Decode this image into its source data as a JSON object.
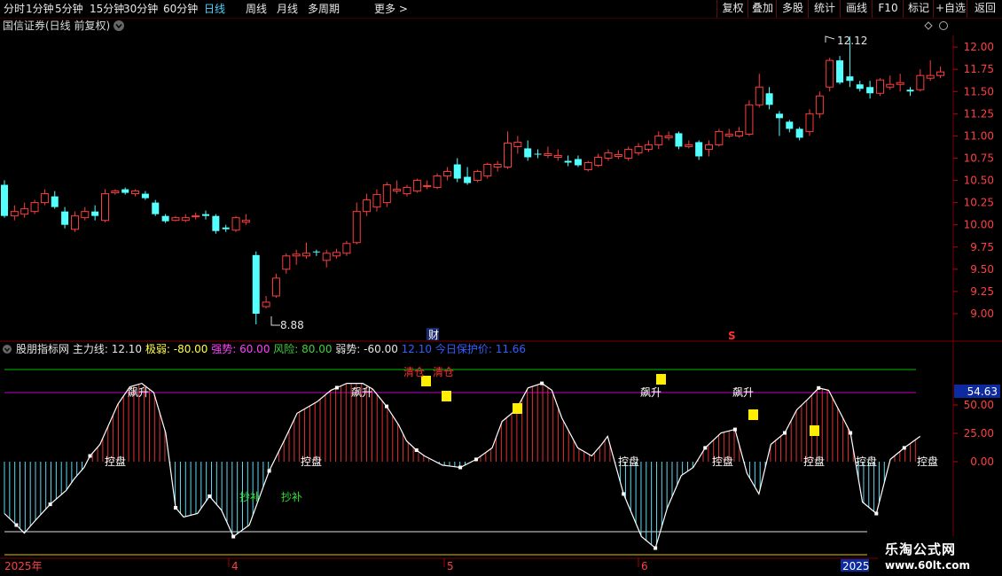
{
  "toolbar": {
    "periods": [
      "分时",
      "1分钟",
      "5分钟",
      "15分钟",
      "30分钟",
      "60分钟",
      "日线",
      "周线",
      "月线",
      "多周期",
      "更多 >"
    ],
    "active_period": "日线",
    "actions": [
      "复权",
      "叠加",
      "多股",
      "统计",
      "画线",
      "F10",
      "标记",
      "+自选",
      "返回"
    ]
  },
  "stock_title": "国信证券(日线 前复权)",
  "main_chart": {
    "price_ticks": [
      "12.00",
      "11.75",
      "11.50",
      "11.25",
      "11.00",
      "10.75",
      "10.50",
      "10.25",
      "10.00",
      "9.75",
      "9.50",
      "9.25",
      "9.00"
    ],
    "high_label": "12.12",
    "low_label": "8.88",
    "cai_marker": "财",
    "s_marker": "S"
  },
  "indicator": {
    "name": "股朋指标网",
    "items": [
      {
        "label": "主力线:",
        "value": "12.10",
        "color": "#e6e6e6"
      },
      {
        "label": "极弱:",
        "value": "-80.00",
        "color": "#ffff40"
      },
      {
        "label": "强势:",
        "value": "60.00",
        "color": "#ff40ff"
      },
      {
        "label": "风险:",
        "value": "80.00",
        "color": "#40d040"
      },
      {
        "label": "弱势:",
        "value": "-60.00",
        "color": "#e6e6e6"
      }
    ],
    "value_text": "12.10",
    "protect_label": "今日保护价:",
    "protect_value": "11.66",
    "ticks": [
      "50.00",
      "25.00",
      "0.00"
    ],
    "current_value": "54.63",
    "tags": {
      "piao": "飙升",
      "kong": "控盘",
      "chao": "抄补",
      "qing": "清仓"
    }
  },
  "date_axis": {
    "start": "2025年",
    "m4": "4",
    "m5": "5",
    "m6": "6",
    "end": "2025"
  },
  "chart_data": {
    "type": "line",
    "candles": [
      [
        10.45,
        10.1,
        10.5,
        10.08
      ],
      [
        10.1,
        10.15,
        10.22,
        10.05
      ],
      [
        10.12,
        10.18,
        10.25,
        10.08
      ],
      [
        10.15,
        10.25,
        10.28,
        10.12
      ],
      [
        10.25,
        10.35,
        10.4,
        10.22
      ],
      [
        10.32,
        10.2,
        10.38,
        10.18
      ],
      [
        10.15,
        10.0,
        10.2,
        9.96
      ],
      [
        9.95,
        10.1,
        10.15,
        9.92
      ],
      [
        10.08,
        10.15,
        10.2,
        10.05
      ],
      [
        10.15,
        10.1,
        10.22,
        10.05
      ],
      [
        10.05,
        10.35,
        10.4,
        10.03
      ],
      [
        10.36,
        10.38,
        10.4,
        10.34
      ],
      [
        10.4,
        10.36,
        10.42,
        10.34
      ],
      [
        10.35,
        10.38,
        10.4,
        10.32
      ],
      [
        10.35,
        10.3,
        10.38,
        10.28
      ],
      [
        10.25,
        10.12,
        10.28,
        10.1
      ],
      [
        10.1,
        10.04,
        10.12,
        10.02
      ],
      [
        10.05,
        10.08,
        10.1,
        10.04
      ],
      [
        10.05,
        10.08,
        10.12,
        10.03
      ],
      [
        10.09,
        10.1,
        10.14,
        10.06
      ],
      [
        10.12,
        10.1,
        10.16,
        10.06
      ],
      [
        10.1,
        9.93,
        10.12,
        9.9
      ],
      [
        9.97,
        9.95,
        10.0,
        9.92
      ],
      [
        9.94,
        10.08,
        10.1,
        9.92
      ],
      [
        10.03,
        10.05,
        10.12,
        10.0
      ],
      [
        9.66,
        9.0,
        9.7,
        8.88
      ],
      [
        9.08,
        9.13,
        9.2,
        9.06
      ],
      [
        9.2,
        9.4,
        9.45,
        9.18
      ],
      [
        9.5,
        9.65,
        9.68,
        9.45
      ],
      [
        9.65,
        9.67,
        9.72,
        9.55
      ],
      [
        9.65,
        9.68,
        9.8,
        9.62
      ],
      [
        9.7,
        9.69,
        9.72,
        9.65
      ],
      [
        9.6,
        9.68,
        9.72,
        9.52
      ],
      [
        9.65,
        9.69,
        9.73,
        9.62
      ],
      [
        9.68,
        9.79,
        9.82,
        9.65
      ],
      [
        9.8,
        10.15,
        10.25,
        9.78
      ],
      [
        10.15,
        10.28,
        10.35,
        10.1
      ],
      [
        10.2,
        10.34,
        10.4,
        10.15
      ],
      [
        10.25,
        10.45,
        10.48,
        10.2
      ],
      [
        10.38,
        10.4,
        10.5,
        10.35
      ],
      [
        10.35,
        10.42,
        10.45,
        10.32
      ],
      [
        10.38,
        10.5,
        10.52,
        10.36
      ],
      [
        10.43,
        10.44,
        10.5,
        10.4
      ],
      [
        10.42,
        10.55,
        10.58,
        10.4
      ],
      [
        10.55,
        10.6,
        10.65,
        10.5
      ],
      [
        10.68,
        10.52,
        10.75,
        10.48
      ],
      [
        10.54,
        10.47,
        10.65,
        10.45
      ],
      [
        10.5,
        10.6,
        10.62,
        10.48
      ],
      [
        10.55,
        10.68,
        10.7,
        10.52
      ],
      [
        10.65,
        10.68,
        10.72,
        10.6
      ],
      [
        10.65,
        10.92,
        11.05,
        10.63
      ],
      [
        10.88,
        10.93,
        11.0,
        10.8
      ],
      [
        10.86,
        10.76,
        10.95,
        10.72
      ],
      [
        10.8,
        10.79,
        10.85,
        10.75
      ],
      [
        10.78,
        10.8,
        10.88,
        10.75
      ],
      [
        10.76,
        10.78,
        10.85,
        10.72
      ],
      [
        10.72,
        10.7,
        10.78,
        10.66
      ],
      [
        10.74,
        10.67,
        10.78,
        10.65
      ],
      [
        10.62,
        10.7,
        10.72,
        10.6
      ],
      [
        10.67,
        10.76,
        10.8,
        10.65
      ],
      [
        10.75,
        10.81,
        10.85,
        10.72
      ],
      [
        10.77,
        10.79,
        10.84,
        10.74
      ],
      [
        10.75,
        10.85,
        10.88,
        10.72
      ],
      [
        10.81,
        10.88,
        10.92,
        10.78
      ],
      [
        10.85,
        10.9,
        10.95,
        10.82
      ],
      [
        10.9,
        11.0,
        11.05,
        10.85
      ],
      [
        10.98,
        11.0,
        11.05,
        10.95
      ],
      [
        11.03,
        10.88,
        11.05,
        10.85
      ],
      [
        10.88,
        10.9,
        10.95,
        10.86
      ],
      [
        10.93,
        10.77,
        10.95,
        10.73
      ],
      [
        10.85,
        10.9,
        10.95,
        10.77
      ],
      [
        10.9,
        11.05,
        11.08,
        10.88
      ],
      [
        11.0,
        11.02,
        11.08,
        10.98
      ],
      [
        11.0,
        11.05,
        11.1,
        10.98
      ],
      [
        11.02,
        11.35,
        11.4,
        11.0
      ],
      [
        11.35,
        11.55,
        11.7,
        11.32
      ],
      [
        11.48,
        11.35,
        11.55,
        11.3
      ],
      [
        11.25,
        11.2,
        11.28,
        11.0
      ],
      [
        11.16,
        11.08,
        11.18,
        11.04
      ],
      [
        11.08,
        10.98,
        11.1,
        10.95
      ],
      [
        11.05,
        11.25,
        11.3,
        11.0
      ],
      [
        11.25,
        11.45,
        11.5,
        11.2
      ],
      [
        11.55,
        11.85,
        11.88,
        11.5
      ],
      [
        11.85,
        11.6,
        11.9,
        11.58
      ],
      [
        11.67,
        11.62,
        12.12,
        11.55
      ],
      [
        11.58,
        11.53,
        11.62,
        11.5
      ],
      [
        11.55,
        11.48,
        11.62,
        11.42
      ],
      [
        11.48,
        11.63,
        11.65,
        11.45
      ],
      [
        11.55,
        11.58,
        11.68,
        11.52
      ],
      [
        11.58,
        11.6,
        11.7,
        11.5
      ],
      [
        11.52,
        11.5,
        11.55,
        11.45
      ],
      [
        11.52,
        11.68,
        11.75,
        11.5
      ],
      [
        11.65,
        11.68,
        11.85,
        11.62
      ],
      [
        11.68,
        11.72,
        11.78,
        11.65
      ]
    ],
    "indicator_series": {
      "name": "主力线",
      "x": [
        0,
        6,
        10,
        15,
        23,
        31,
        35,
        40,
        43,
        48,
        57,
        63,
        69,
        75,
        81,
        86,
        90,
        97,
        103,
        109,
        115,
        123,
        130,
        133,
        141,
        147,
        150,
        157,
        164,
        172,
        180,
        185,
        192,
        198,
        202,
        207,
        211,
        220,
        229,
        237,
        245,
        250,
        257,
        263,
        270,
        275,
        280,
        288,
        295,
        300,
        303,
        311,
        320,
        327,
        333,
        340,
        346,
        352,
        360,
        367,
        373,
        379,
        385,
        392,
        398,
        404,
        409,
        414,
        420,
        425,
        431,
        438,
        445,
        452,
        460
      ],
      "y": [
        -45,
        -55,
        -62,
        -52,
        -37,
        -25,
        -15,
        -5,
        5,
        15,
        50,
        65,
        68,
        60,
        25,
        -40,
        -48,
        -45,
        -30,
        -42,
        -65,
        -55,
        -22,
        -8,
        20,
        42,
        45,
        52,
        62,
        68,
        68,
        63,
        48,
        32,
        18,
        10,
        5,
        -3,
        -5,
        2,
        12,
        35,
        45,
        64,
        68,
        62,
        38,
        12,
        5,
        15,
        22,
        -28,
        -65,
        -75,
        -40,
        -12,
        -5,
        12,
        25,
        28,
        -10,
        -28,
        15,
        25,
        45,
        55,
        64,
        62,
        42,
        25,
        -35,
        -45,
        2,
        12,
        22
      ]
    },
    "level_lines": {
      "risk": 80,
      "strong": 60,
      "weak": -60,
      "extreme_weak": -80
    }
  }
}
